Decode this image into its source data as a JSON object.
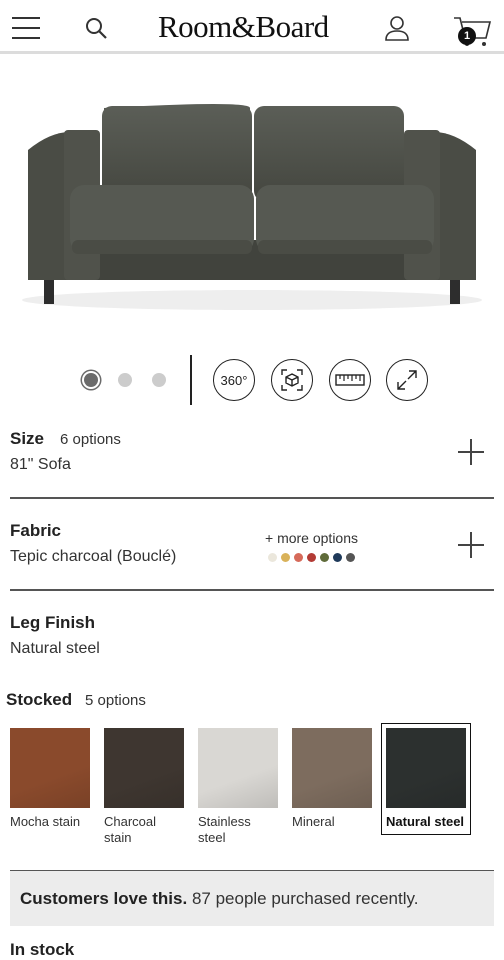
{
  "header": {
    "logo": "Room&Board",
    "cart_count": "1",
    "icons": [
      "menu-icon",
      "search-icon",
      "account-icon",
      "cart-icon"
    ]
  },
  "product_image": {
    "alt": "Sofa in Tepic charcoal",
    "fabric_color": "#4b4d47"
  },
  "gallery": {
    "slide_count": 3,
    "active_slide": 1,
    "tools": {
      "view360_label": "360°"
    }
  },
  "size": {
    "title": "Size",
    "options_count": "6 options",
    "value": "81\" Sofa"
  },
  "fabric": {
    "title": "Fabric",
    "value": "Tepic charcoal (Bouclé)",
    "more_options": "+ more options",
    "swatch_colors": [
      "#ebe7dc",
      "#d9b25a",
      "#d66a5a",
      "#b33b35",
      "#5f6b3a",
      "#1f3a5a",
      "#555555"
    ]
  },
  "leg_finish": {
    "title": "Leg Finish",
    "value": "Natural steel"
  },
  "stocked": {
    "title": "Stocked",
    "options_count": "5 options",
    "finishes": [
      {
        "label": "Mocha stain",
        "color": "#8a4a2c"
      },
      {
        "label": "Charcoal stain",
        "color": "#3e3630"
      },
      {
        "label": "Stainless steel",
        "color": "#d9d7d3"
      },
      {
        "label": "Mineral",
        "color": "#7d6c5e"
      },
      {
        "label": "Natural steel",
        "color": "#2c302f",
        "selected": true
      }
    ]
  },
  "banner": {
    "bold": "Customers love this.",
    "text": " 87 people purchased recently."
  },
  "availability": "In stock"
}
